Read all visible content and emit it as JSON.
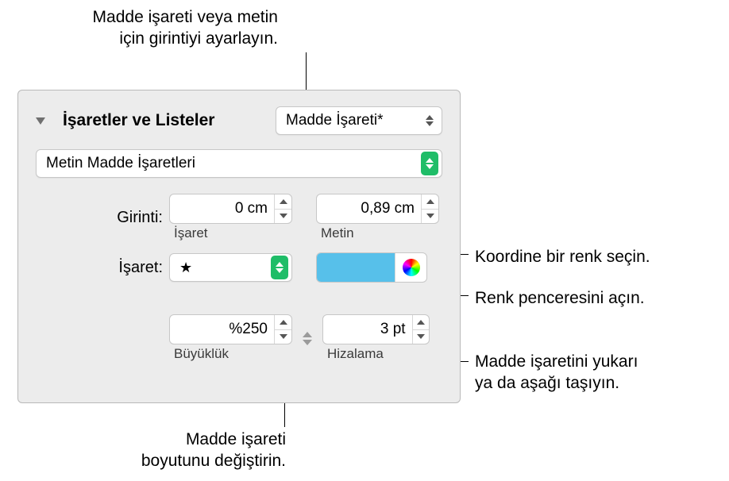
{
  "callouts": {
    "top": "Madde işareti veya metin\niçin girintiyi ayarlayın.",
    "color_coord": "Koordine bir renk seçin.",
    "color_window": "Renk penceresini açın.",
    "align": "Madde işaretini yukarı\nya da aşağı taşıyın.",
    "size": "Madde işareti\nboyutunu değiştirin."
  },
  "section": {
    "title": "İşaretler ve Listeler",
    "style": "Madde İşareti*"
  },
  "bullet_type_popup": "Metin Madde İşaretleri",
  "indent": {
    "label": "Girinti:",
    "bullet_value": "0 cm",
    "bullet_sub": "İşaret",
    "text_value": "0,89 cm",
    "text_sub": "Metin"
  },
  "marker": {
    "label": "İşaret:",
    "glyph": "★"
  },
  "color": {
    "swatch_hex": "#57c0ea"
  },
  "size": {
    "value": "%250",
    "sub": "Büyüklük"
  },
  "align": {
    "value": "3 pt",
    "sub": "Hizalama"
  }
}
